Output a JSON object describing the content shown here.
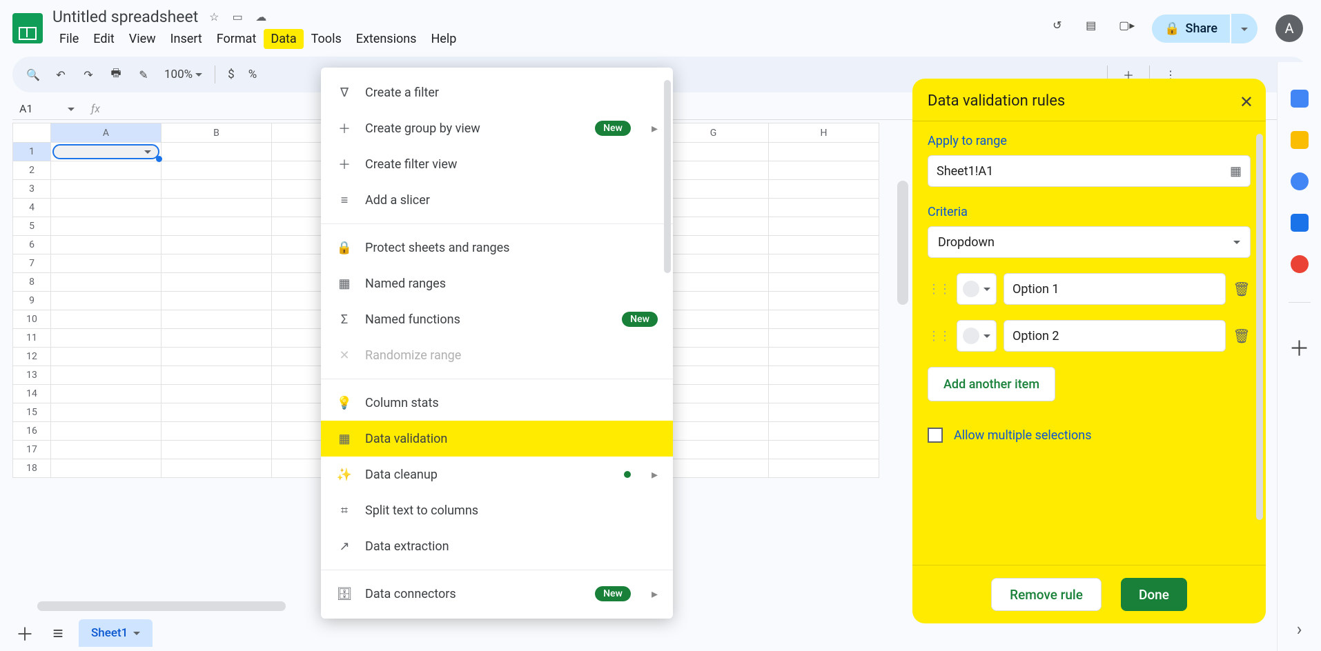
{
  "doc": {
    "title": "Untitled spreadsheet"
  },
  "menubar": {
    "file": "File",
    "edit": "Edit",
    "view": "View",
    "insert": "Insert",
    "format": "Format",
    "data": "Data",
    "tools": "Tools",
    "extensions": "Extensions",
    "help": "Help"
  },
  "share": "Share",
  "avatar": "A",
  "toolbar": {
    "zoom": "100%",
    "currency": "$",
    "percent": "%"
  },
  "namebox": "A1",
  "columns": [
    "A",
    "B",
    "G",
    "H"
  ],
  "menu": {
    "create_filter": "Create a filter",
    "create_group_by_view": "Create group by view",
    "create_filter_view": "Create filter view",
    "add_slicer": "Add a slicer",
    "protect": "Protect sheets and ranges",
    "named_ranges": "Named ranges",
    "named_functions": "Named functions",
    "randomize": "Randomize range",
    "column_stats": "Column stats",
    "data_validation": "Data validation",
    "data_cleanup": "Data cleanup",
    "split": "Split text to columns",
    "extraction": "Data extraction",
    "connectors": "Data connectors",
    "new_badge": "New"
  },
  "panel": {
    "title": "Data validation rules",
    "apply_label": "Apply to range",
    "range": "Sheet1!A1",
    "criteria_label": "Criteria",
    "criteria_value": "Dropdown",
    "options": [
      "Option 1",
      "Option 2"
    ],
    "add": "Add another item",
    "allow": "Allow multiple selections",
    "remove": "Remove rule",
    "done": "Done"
  },
  "tab": "Sheet1"
}
